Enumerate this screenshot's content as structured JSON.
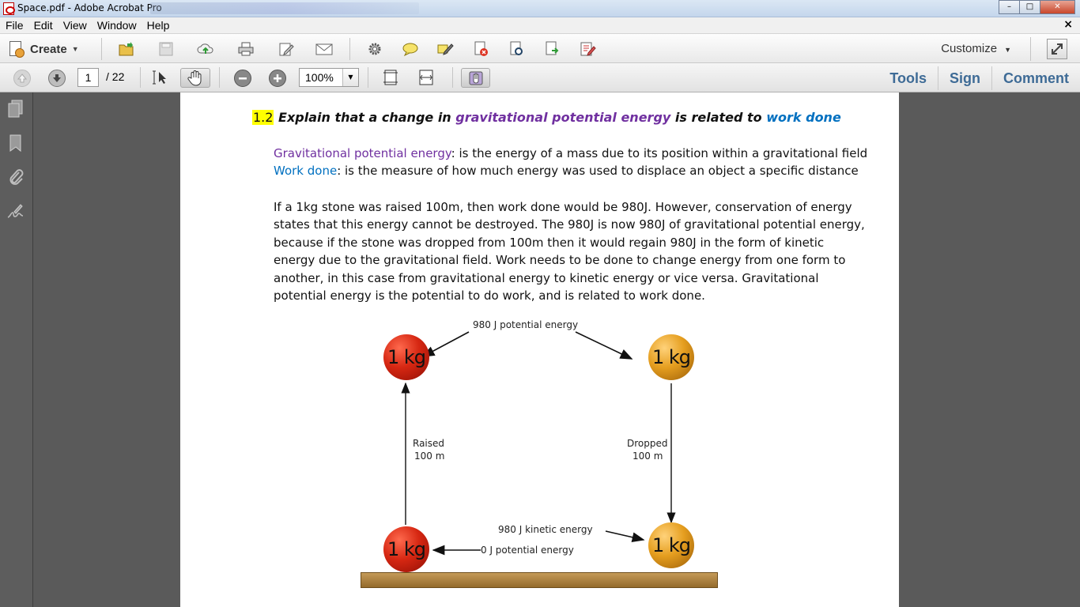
{
  "window": {
    "title": "Space.pdf - Adobe Acrobat Pro",
    "buttons": {
      "minimize": "–",
      "maximize": "□",
      "close": "✕"
    }
  },
  "menubar": {
    "items": [
      "File",
      "Edit",
      "View",
      "Window",
      "Help"
    ],
    "close_doc": "×"
  },
  "toolbar1": {
    "create_label": "Create",
    "customize_label": "Customize",
    "icons": [
      "open-folder-icon",
      "save-icon",
      "upload-cloud-icon",
      "print-icon",
      "edit-icon",
      "email-icon",
      "gear-icon",
      "comment-icon",
      "highlight-icon",
      "delete-page-icon",
      "page-settings-icon",
      "export-icon",
      "form-icon"
    ]
  },
  "toolbar2": {
    "page_current": "1",
    "page_total": "/ 22",
    "zoom": "100%",
    "links": {
      "tools": "Tools",
      "sign": "Sign",
      "comment": "Comment"
    }
  },
  "navpane": {
    "icons": [
      "pages-icon",
      "bookmark-icon",
      "attachment-icon",
      "signature-icon"
    ]
  },
  "document": {
    "heading": {
      "number": "1.2",
      "part1": " Explain that a change in ",
      "term1": "gravitational potential energy",
      "part2": " is related to ",
      "term2": "work done"
    },
    "defs": [
      {
        "term": "Gravitational potential energy",
        "text": ": is the energy of a mass due to its position within a gravitational field"
      },
      {
        "term": "Work done",
        "text": ": is the measure of how much energy was used to displace an object a specific distance"
      }
    ],
    "paragraph": "If a 1kg stone was raised 100m, then work done would be 980J. However, conservation of energy states that this energy cannot be destroyed. The 980J is now 980J of gravitational potential energy, because if the stone was dropped from 100m then it would regain 980J in the form of kinetic energy due to the gravitational field. Work needs to be done to change energy from one form to another, in this case from gravitational energy to kinetic energy or vice versa. Gravitational potential energy is the potential to do work, and is related to work done.",
    "diagram": {
      "top_label": "980 J potential energy",
      "raised_label_1": "Raised",
      "raised_label_2": "100 m",
      "dropped_label_1": "Dropped",
      "dropped_label_2": "100 m",
      "kinetic_label": "980 J kinetic energy",
      "zero_label": "0 J potential energy",
      "ball_label": "1 kg",
      "colors": {
        "red_ball": "#d62712",
        "gold_ball": "#e59e1f",
        "ground": "#b48a48"
      }
    }
  }
}
